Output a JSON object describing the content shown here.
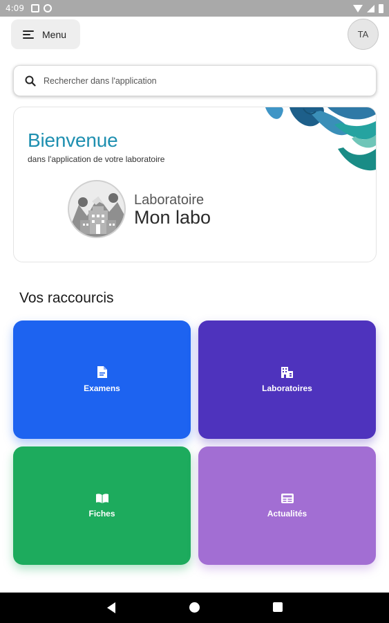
{
  "status_bar": {
    "time": "4:09"
  },
  "header": {
    "menu_label": "Menu",
    "avatar_initials": "TA"
  },
  "search": {
    "placeholder": "Rechercher dans l'application"
  },
  "welcome": {
    "title": "Bienvenue",
    "subtitle": "dans l'application de votre laboratoire",
    "lab_label": "Laboratoire",
    "lab_name": "Mon labo"
  },
  "shortcuts": {
    "title": "Vos raccourcis",
    "items": [
      {
        "label": "Examens",
        "icon": "document-icon",
        "color": "#1d63f0"
      },
      {
        "label": "Laboratoires",
        "icon": "building-icon",
        "color": "#4e33bd"
      },
      {
        "label": "Fiches",
        "icon": "book-icon",
        "color": "#1dab5d"
      },
      {
        "label": "Actualités",
        "icon": "newspaper-icon",
        "color": "#a26ed3"
      }
    ]
  },
  "colors": {
    "brand_title": "#1e8fb0"
  }
}
